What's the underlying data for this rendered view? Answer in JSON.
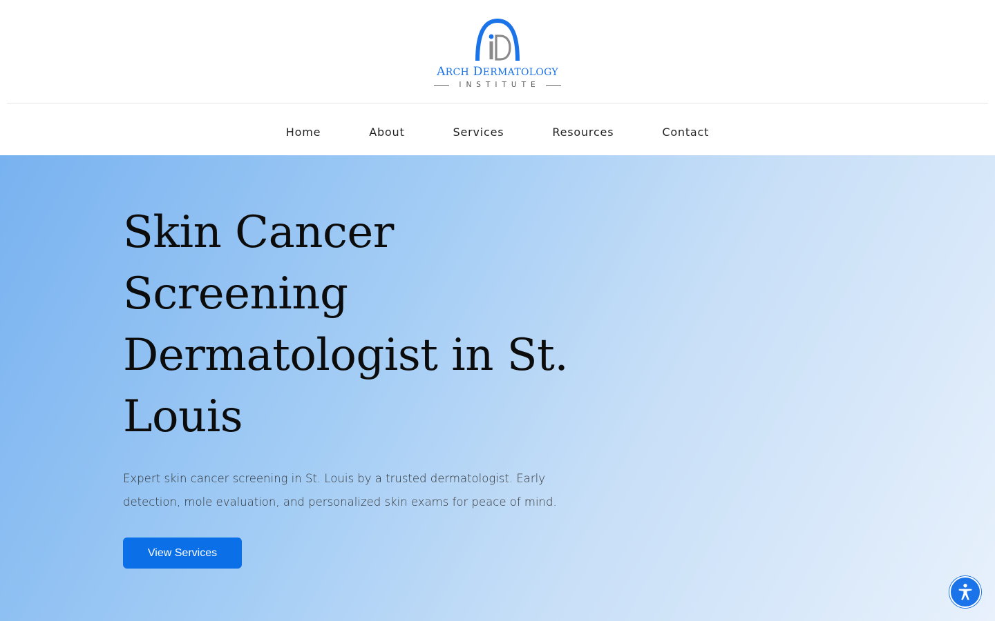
{
  "logo": {
    "title_first_initial": "A",
    "title_first_rest": "RCH",
    "title_second_initial": "D",
    "title_second_rest": "ERMATOLOGY",
    "subtitle": "INSTITUTE",
    "mark_letter": "D"
  },
  "nav": {
    "items": [
      {
        "label": "Home"
      },
      {
        "label": "About"
      },
      {
        "label": "Services"
      },
      {
        "label": "Resources"
      },
      {
        "label": "Contact"
      }
    ]
  },
  "hero": {
    "title": "Skin Cancer Screening Dermatologist in St. Louis",
    "description": "Expert skin cancer screening in St. Louis by a trusted dermatologist. Early detection, mole evaluation, and personalized skin exams for peace of mind.",
    "cta_label": "View Services"
  },
  "colors": {
    "brand_blue": "#1a73e8",
    "button_blue": "#0b6fe8",
    "hero_gradient_start": "#78b2f0",
    "hero_gradient_end": "#e8f1fc"
  },
  "icons": {
    "logo_mark": "arch-id-logo-icon",
    "accessibility": "accessibility-person-icon"
  }
}
